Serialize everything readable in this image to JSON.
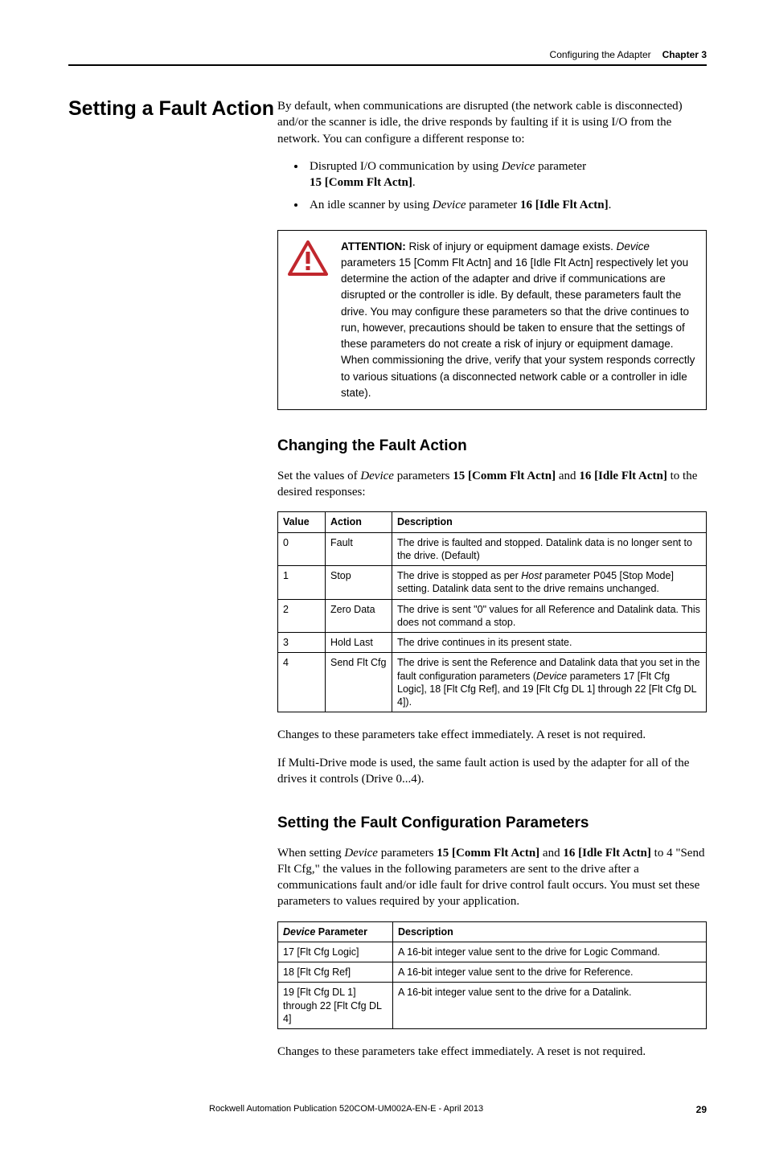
{
  "header": {
    "section": "Configuring the Adapter",
    "chapter": "Chapter 3"
  },
  "title": "Setting a Fault Action",
  "intro": "By default, when communications are disrupted (the network cable is disconnected) and/or the scanner is idle, the drive responds by faulting if it is using I/O from the network. You can configure a different response to:",
  "bullets": {
    "b1a": "Disrupted I/O communication by using ",
    "b1b": "Device",
    "b1c": " parameter ",
    "b1d": "15 [Comm Flt Actn]",
    "b1e": ".",
    "b2a": "An idle scanner by using ",
    "b2b": "Device",
    "b2c": " parameter ",
    "b2d": "16 [Idle Flt Actn]",
    "b2e": "."
  },
  "attention": {
    "label": "ATTENTION:",
    "p1": " Risk of injury or equipment damage exists. ",
    "p2": "Device",
    "p3": " parameters 15 [Comm Flt Actn] and 16 [Idle Flt Actn] respectively let you determine the action of the adapter and drive if communications are disrupted or the controller is idle. By default, these parameters fault the drive. You may configure these parameters so that the drive continues to run, however, precautions should be taken to ensure that the settings of these parameters do not create a risk of injury or equipment damage. When commissioning the drive, verify that your system responds correctly to various situations (a disconnected network cable or a controller in idle state)."
  },
  "sub1": {
    "heading": "Changing the Fault Action",
    "p1a": "Set the values of ",
    "p1b": "Device",
    "p1c": " parameters ",
    "p1d": "15 [Comm Flt Actn]",
    "p1e": " and ",
    "p1f": "16 [Idle Flt Actn]",
    "p1g": " to the desired responses:"
  },
  "table1": {
    "h1": "Value",
    "h2": "Action",
    "h3": "Description",
    "r1c1": "0",
    "r1c2": "Fault",
    "r1c3": "The drive is faulted and stopped. Datalink data is no longer sent to the drive. (Default)",
    "r2c1": "1",
    "r2c2": "Stop",
    "r2c3a": "The drive is stopped as per ",
    "r2c3b": "Host",
    "r2c3c": " parameter P045 [Stop Mode] setting. Datalink data sent to the drive remains unchanged.",
    "r3c1": "2",
    "r3c2": "Zero Data",
    "r3c3": "The drive is sent \"0\" values for all Reference and Datalink data. This does not command a stop.",
    "r4c1": "3",
    "r4c2": "Hold Last",
    "r4c3": "The drive continues in its present state.",
    "r5c1": "4",
    "r5c2": "Send Flt Cfg",
    "r5c3a": "The drive is sent the Reference and Datalink data that you set in the fault configuration parameters (",
    "r5c3b": "Device",
    "r5c3c": " parameters 17 [Flt Cfg Logic], 18 [Flt Cfg Ref], and 19 [Flt Cfg DL 1] through 22 [Flt Cfg DL 4])."
  },
  "after1": "Changes to these parameters take effect immediately. A reset is not required.",
  "after2": "If Multi-Drive mode is used, the same fault action is used by the adapter for all of the drives it controls (Drive 0...4).",
  "sub2": {
    "heading": "Setting the Fault Configuration Parameters",
    "p1a": "When setting ",
    "p1b": "Device",
    "p1c": " parameters ",
    "p1d": "15 [Comm Flt Actn]",
    "p1e": " and ",
    "p1f": "16 [Idle Flt Actn]",
    "p1g": " to 4 \"Send Flt Cfg,\" the values in the following parameters are sent to the drive after a communications fault and/or idle fault for drive control fault occurs. You must set these parameters to values required by your application."
  },
  "table2": {
    "h1a": "Device",
    "h1b": " Parameter",
    "h2": "Description",
    "r1c1": "17 [Flt Cfg Logic]",
    "r1c2": "A 16-bit integer value sent to the drive for Logic Command.",
    "r2c1": "18 [Flt Cfg Ref]",
    "r2c2": "A 16-bit integer value sent to the drive for Reference.",
    "r3c1": "19 [Flt Cfg DL 1] through 22 [Flt Cfg DL 4]",
    "r3c2": "A 16-bit integer value sent to the drive for a Datalink."
  },
  "after3": "Changes to these parameters take effect immediately. A reset is not required.",
  "footer": {
    "pub": "Rockwell Automation Publication 520COM-UM002A-EN-E - April 2013",
    "page": "29"
  }
}
